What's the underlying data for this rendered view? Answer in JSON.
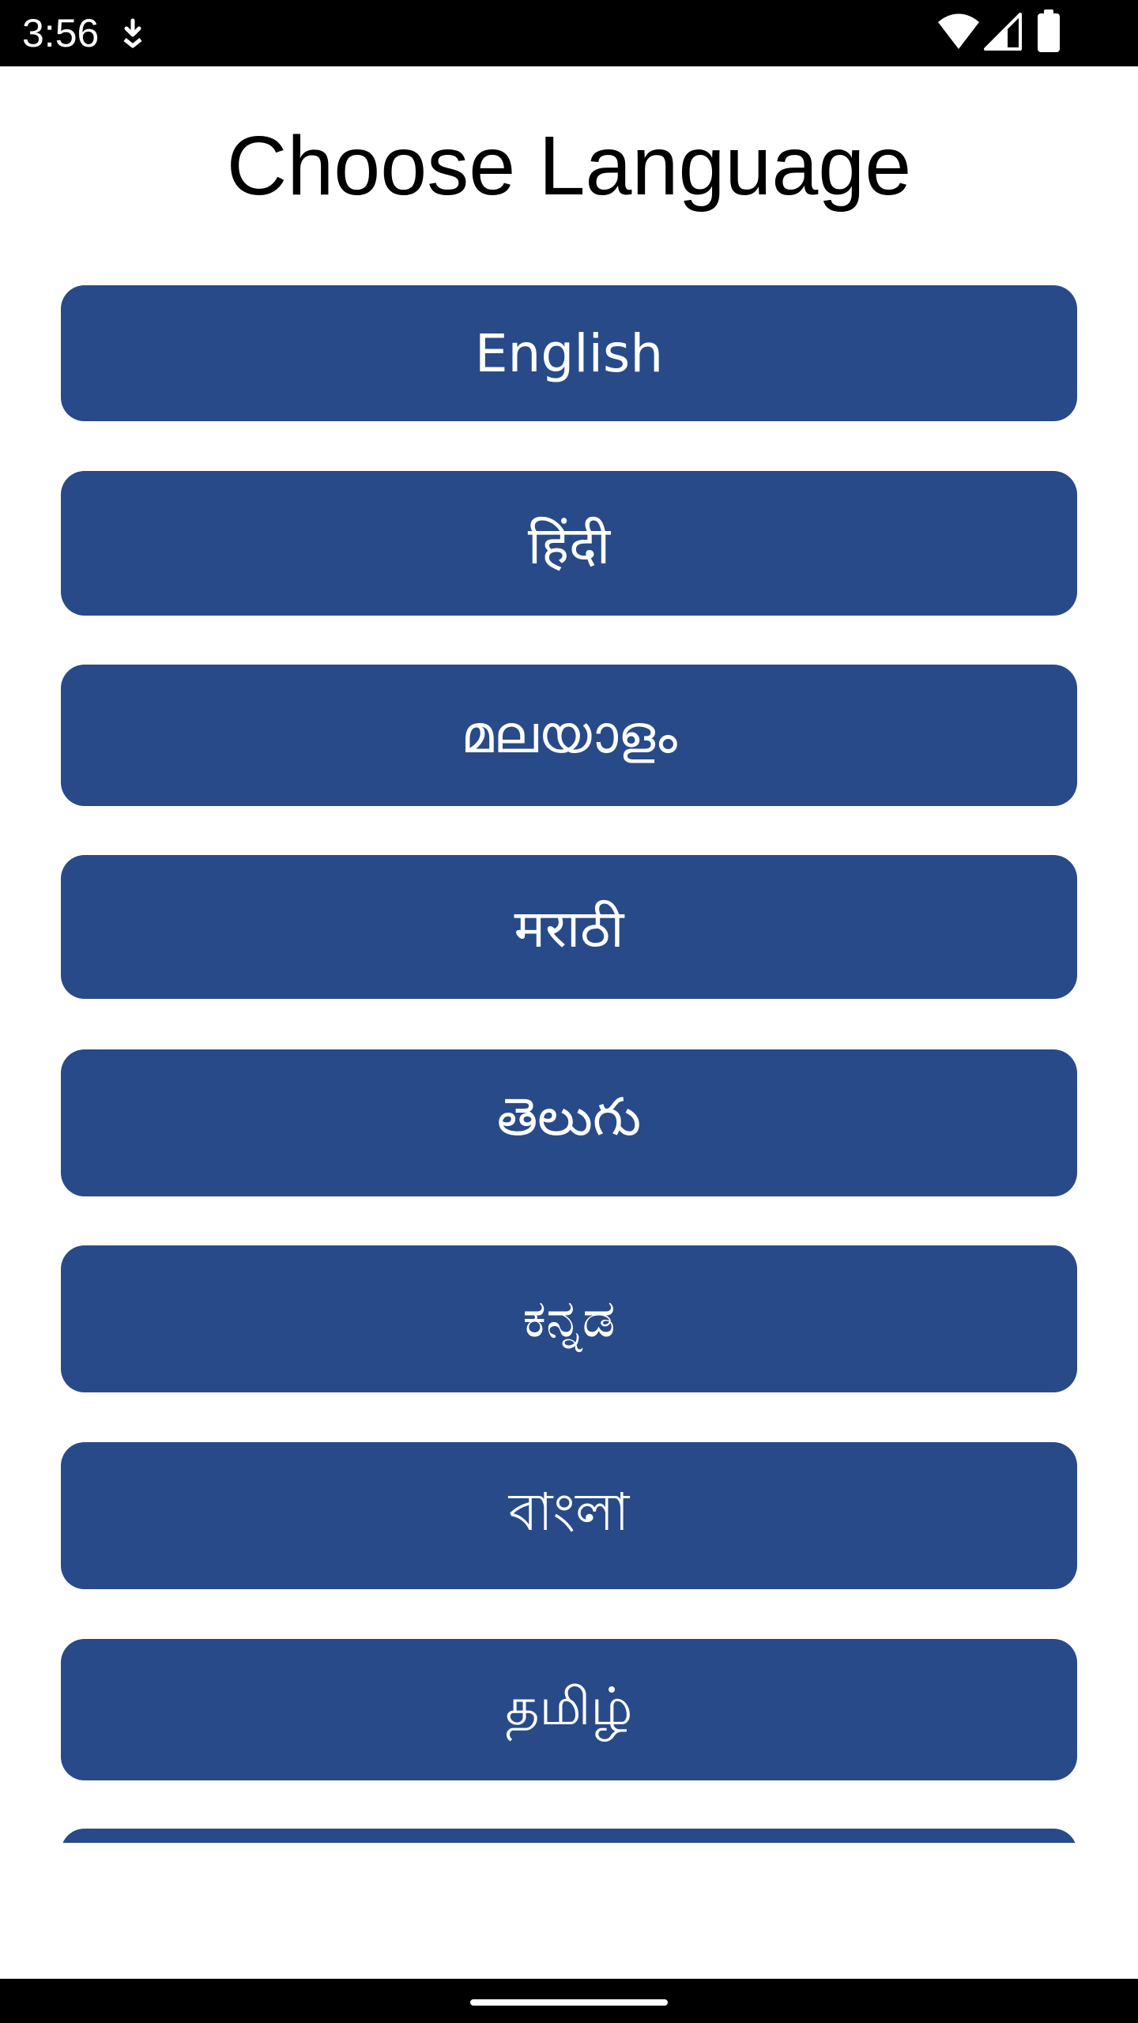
{
  "status_bar": {
    "time": "3:56",
    "icons": [
      "download-icon",
      "wifi-icon",
      "signal-icon",
      "battery-icon"
    ]
  },
  "page": {
    "title": "Choose Language"
  },
  "languages": [
    {
      "label": "English"
    },
    {
      "label": "हिंदी"
    },
    {
      "label": "മലയാളം"
    },
    {
      "label": "मराठी"
    },
    {
      "label": "తెలుగు"
    },
    {
      "label": "ಕನ್ನಡ"
    },
    {
      "label": "বাংলা"
    },
    {
      "label": "தமிழ்"
    },
    {
      "label": ""
    }
  ],
  "colors": {
    "button_bg": "#284a88",
    "button_text": "#ffffff",
    "background": "#ffffff",
    "system_bars": "#000000"
  }
}
